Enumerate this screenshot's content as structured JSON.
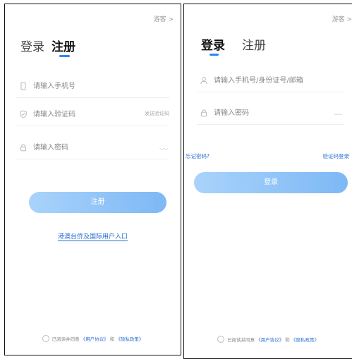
{
  "register_screen": {
    "guest_label": "游客 >",
    "tabs": {
      "login": "登录",
      "register": "注册"
    },
    "phone_placeholder": "请输入手机号",
    "code_placeholder": "请输入验证码",
    "send_code_label": "发送验证码",
    "password_placeholder": "请输入密码",
    "eye_glyph": "‿‿",
    "submit_label": "注册",
    "overseas_link": "港澳台侨及国际用户入口",
    "agreement": {
      "prefix": "已阅读并同意",
      "user_agreement": "《用户协议》",
      "and": "和",
      "privacy_policy": "《隐私政策》"
    }
  },
  "login_screen": {
    "guest_label": "游客 >",
    "tabs": {
      "login": "登录",
      "register": "注册"
    },
    "account_placeholder": "请输入手机号/身份证号/邮箱",
    "password_placeholder": "请输入密码",
    "eye_glyph": "‿‿",
    "forgot_password": "忘记密码?",
    "code_login": "验证码登录",
    "submit_label": "登录",
    "agreement": {
      "prefix": "已阅读并同意",
      "user_agreement": "《用户协议》",
      "and": "和",
      "privacy_policy": "《隐私政策》"
    }
  },
  "colors": {
    "accent": "#2f86f5",
    "link": "#2a6fd6",
    "button_start": "#a9d3fb",
    "button_end": "#7db8f5"
  }
}
